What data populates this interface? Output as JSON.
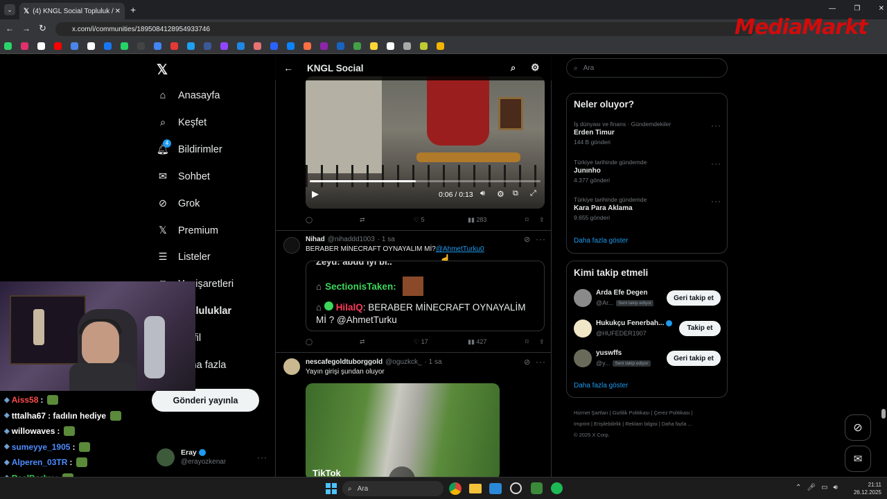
{
  "browser": {
    "tab_title": "(4) KNGL Social Topluluk / X",
    "url": "x.com/i/communities/1895084128954933746",
    "watermark": "MediaMarkt"
  },
  "sidebar": {
    "items": [
      {
        "label": "Anasayfa",
        "icon": "home-icon"
      },
      {
        "label": "Keşfet",
        "icon": "search-icon"
      },
      {
        "label": "Bildirimler",
        "icon": "bell-icon",
        "badge": "4"
      },
      {
        "label": "Sohbet",
        "icon": "mail-icon"
      },
      {
        "label": "Grok",
        "icon": "grok-icon"
      },
      {
        "label": "Premium",
        "icon": "x-icon"
      },
      {
        "label": "Listeler",
        "icon": "list-icon"
      },
      {
        "label": "Yer işaretleri",
        "icon": "bookmark-icon"
      },
      {
        "label": "Topluluklar",
        "icon": "communities-icon"
      },
      {
        "label": "Profil",
        "icon": "profile-icon"
      },
      {
        "label": "Daha fazla",
        "icon": "more-icon"
      }
    ],
    "post_button": "Gönderi yayınla",
    "account": {
      "name": "Eray",
      "handle": "@erayozkenar"
    }
  },
  "feed": {
    "title": "KNGL Social",
    "video": {
      "time": "0:06 / 0:13",
      "progress": 0.46
    },
    "post1_stats": {
      "replies": "",
      "likes": "5",
      "views": "283"
    },
    "post2": {
      "name": "Nihad",
      "handle": "@nihaddd1003",
      "time": "· 1 sa",
      "text": "BERABER MİNECRAFT OYNAYALIM Mİ?",
      "mention": "@AhmetTurku0",
      "embed_top": "Zeyd:  abdu iyi bi..",
      "embed_user1": "SectionisTaken:",
      "embed_user2": "HilalQ",
      "embed_text": ": BERABER MİNECRAFT OYNAYALİM Mİ ? @AhmetTurku",
      "likes": "17",
      "views": "427"
    },
    "post3": {
      "name": "nescafegoldtuborggold",
      "handle": "@oguzkck_",
      "time": "· 1 sa",
      "text": "Yayın girişi şundan oluyor",
      "media_label": "TikTok"
    }
  },
  "right": {
    "search_placeholder": "Ara",
    "trends_title": "Neler oluyor?",
    "trends": [
      {
        "category": "İş dünyası ve finans · Gündemdekiler",
        "name": "Erden Timur",
        "count": "144 B gönderi"
      },
      {
        "category": "Türkiye tarihinde gündemde",
        "name": "Junınho",
        "count": "4.377 gönderi"
      },
      {
        "category": "Türkiye tarihinde gündemde",
        "name": "Kara Para Aklama",
        "count": "9.655 gönderi"
      }
    ],
    "show_more": "Daha fazla göster",
    "follow_title": "Kimi takip etmeli",
    "follows": [
      {
        "name": "Arda Efe Degen",
        "handle": "@Ar...",
        "badge": "Seni takip ediyor",
        "button": "Geri takip et",
        "verified": false
      },
      {
        "name": "Hukukçu Fenerbah...",
        "handle": "@HUFEDER1907",
        "badge": "",
        "button": "Takip et",
        "verified": true
      },
      {
        "name": "yuswffs",
        "handle": "@y...",
        "badge": "Seni takip ediyor",
        "button": "Geri takip et",
        "verified": false
      }
    ],
    "footer": [
      "Hizmet Şartları",
      "Gizlilik Politikası",
      "Çerez Politikası",
      "Imprint",
      "Erişilebilirlik",
      "Reklam bilgisi",
      "Daha fazla ...",
      "© 2025 X Corp."
    ]
  },
  "chat": [
    {
      "user": "Aiss58",
      "msg": ":",
      "color": "#ff4d4d"
    },
    {
      "user": "tttalha67",
      "msg": ": fadılın hediye",
      "color": "#ffffff"
    },
    {
      "user": "willowaves",
      "msg": ":",
      "color": "#ffffff"
    },
    {
      "user": "sumeyye_1905",
      "msg": ":",
      "color": "#4d8cff"
    },
    {
      "user": "Alperen_03TR",
      "msg": ":",
      "color": "#4d8cff"
    },
    {
      "user": "RealBorby",
      "msg": ":",
      "color": "#3cd65a"
    },
    {
      "user": "Tinyw",
      "msg": ":",
      "color": "#ffffff"
    }
  ],
  "taskbar": {
    "search": "Ara",
    "time": "21:11",
    "date": "26.12.2025"
  }
}
